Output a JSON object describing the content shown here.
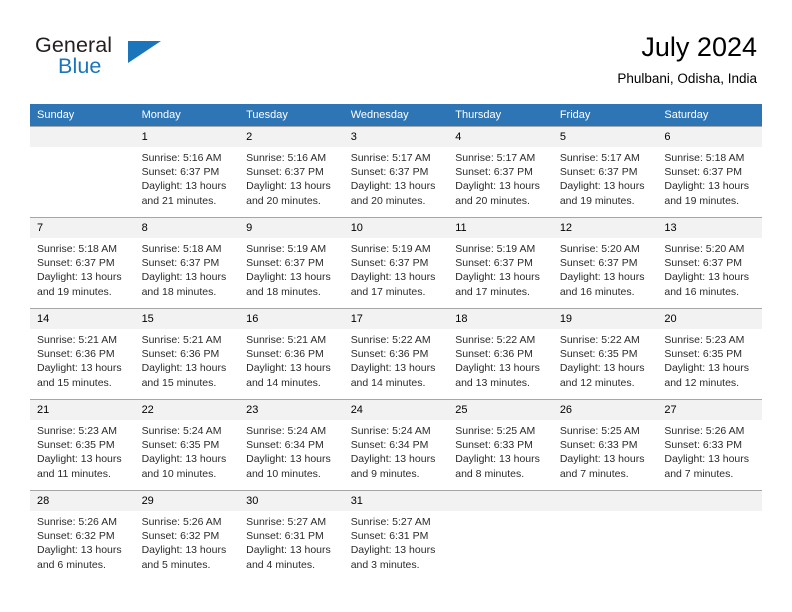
{
  "brand": {
    "name_part1": "General",
    "name_part2": "Blue",
    "accent_color": "#1b75bb"
  },
  "header": {
    "title": "July 2024",
    "subtitle": "Phulbani, Odisha, India"
  },
  "calendar": {
    "header_color": "#2e75b6",
    "weekdays": [
      "Sunday",
      "Monday",
      "Tuesday",
      "Wednesday",
      "Thursday",
      "Friday",
      "Saturday"
    ],
    "weeks": [
      [
        {
          "day": "",
          "sunrise": "",
          "sunset": "",
          "daylight1": "",
          "daylight2": ""
        },
        {
          "day": "1",
          "sunrise": "Sunrise: 5:16 AM",
          "sunset": "Sunset: 6:37 PM",
          "daylight1": "Daylight: 13 hours",
          "daylight2": "and 21 minutes."
        },
        {
          "day": "2",
          "sunrise": "Sunrise: 5:16 AM",
          "sunset": "Sunset: 6:37 PM",
          "daylight1": "Daylight: 13 hours",
          "daylight2": "and 20 minutes."
        },
        {
          "day": "3",
          "sunrise": "Sunrise: 5:17 AM",
          "sunset": "Sunset: 6:37 PM",
          "daylight1": "Daylight: 13 hours",
          "daylight2": "and 20 minutes."
        },
        {
          "day": "4",
          "sunrise": "Sunrise: 5:17 AM",
          "sunset": "Sunset: 6:37 PM",
          "daylight1": "Daylight: 13 hours",
          "daylight2": "and 20 minutes."
        },
        {
          "day": "5",
          "sunrise": "Sunrise: 5:17 AM",
          "sunset": "Sunset: 6:37 PM",
          "daylight1": "Daylight: 13 hours",
          "daylight2": "and 19 minutes."
        },
        {
          "day": "6",
          "sunrise": "Sunrise: 5:18 AM",
          "sunset": "Sunset: 6:37 PM",
          "daylight1": "Daylight: 13 hours",
          "daylight2": "and 19 minutes."
        }
      ],
      [
        {
          "day": "7",
          "sunrise": "Sunrise: 5:18 AM",
          "sunset": "Sunset: 6:37 PM",
          "daylight1": "Daylight: 13 hours",
          "daylight2": "and 19 minutes."
        },
        {
          "day": "8",
          "sunrise": "Sunrise: 5:18 AM",
          "sunset": "Sunset: 6:37 PM",
          "daylight1": "Daylight: 13 hours",
          "daylight2": "and 18 minutes."
        },
        {
          "day": "9",
          "sunrise": "Sunrise: 5:19 AM",
          "sunset": "Sunset: 6:37 PM",
          "daylight1": "Daylight: 13 hours",
          "daylight2": "and 18 minutes."
        },
        {
          "day": "10",
          "sunrise": "Sunrise: 5:19 AM",
          "sunset": "Sunset: 6:37 PM",
          "daylight1": "Daylight: 13 hours",
          "daylight2": "and 17 minutes."
        },
        {
          "day": "11",
          "sunrise": "Sunrise: 5:19 AM",
          "sunset": "Sunset: 6:37 PM",
          "daylight1": "Daylight: 13 hours",
          "daylight2": "and 17 minutes."
        },
        {
          "day": "12",
          "sunrise": "Sunrise: 5:20 AM",
          "sunset": "Sunset: 6:37 PM",
          "daylight1": "Daylight: 13 hours",
          "daylight2": "and 16 minutes."
        },
        {
          "day": "13",
          "sunrise": "Sunrise: 5:20 AM",
          "sunset": "Sunset: 6:37 PM",
          "daylight1": "Daylight: 13 hours",
          "daylight2": "and 16 minutes."
        }
      ],
      [
        {
          "day": "14",
          "sunrise": "Sunrise: 5:21 AM",
          "sunset": "Sunset: 6:36 PM",
          "daylight1": "Daylight: 13 hours",
          "daylight2": "and 15 minutes."
        },
        {
          "day": "15",
          "sunrise": "Sunrise: 5:21 AM",
          "sunset": "Sunset: 6:36 PM",
          "daylight1": "Daylight: 13 hours",
          "daylight2": "and 15 minutes."
        },
        {
          "day": "16",
          "sunrise": "Sunrise: 5:21 AM",
          "sunset": "Sunset: 6:36 PM",
          "daylight1": "Daylight: 13 hours",
          "daylight2": "and 14 minutes."
        },
        {
          "day": "17",
          "sunrise": "Sunrise: 5:22 AM",
          "sunset": "Sunset: 6:36 PM",
          "daylight1": "Daylight: 13 hours",
          "daylight2": "and 14 minutes."
        },
        {
          "day": "18",
          "sunrise": "Sunrise: 5:22 AM",
          "sunset": "Sunset: 6:36 PM",
          "daylight1": "Daylight: 13 hours",
          "daylight2": "and 13 minutes."
        },
        {
          "day": "19",
          "sunrise": "Sunrise: 5:22 AM",
          "sunset": "Sunset: 6:35 PM",
          "daylight1": "Daylight: 13 hours",
          "daylight2": "and 12 minutes."
        },
        {
          "day": "20",
          "sunrise": "Sunrise: 5:23 AM",
          "sunset": "Sunset: 6:35 PM",
          "daylight1": "Daylight: 13 hours",
          "daylight2": "and 12 minutes."
        }
      ],
      [
        {
          "day": "21",
          "sunrise": "Sunrise: 5:23 AM",
          "sunset": "Sunset: 6:35 PM",
          "daylight1": "Daylight: 13 hours",
          "daylight2": "and 11 minutes."
        },
        {
          "day": "22",
          "sunrise": "Sunrise: 5:24 AM",
          "sunset": "Sunset: 6:35 PM",
          "daylight1": "Daylight: 13 hours",
          "daylight2": "and 10 minutes."
        },
        {
          "day": "23",
          "sunrise": "Sunrise: 5:24 AM",
          "sunset": "Sunset: 6:34 PM",
          "daylight1": "Daylight: 13 hours",
          "daylight2": "and 10 minutes."
        },
        {
          "day": "24",
          "sunrise": "Sunrise: 5:24 AM",
          "sunset": "Sunset: 6:34 PM",
          "daylight1": "Daylight: 13 hours",
          "daylight2": "and 9 minutes."
        },
        {
          "day": "25",
          "sunrise": "Sunrise: 5:25 AM",
          "sunset": "Sunset: 6:33 PM",
          "daylight1": "Daylight: 13 hours",
          "daylight2": "and 8 minutes."
        },
        {
          "day": "26",
          "sunrise": "Sunrise: 5:25 AM",
          "sunset": "Sunset: 6:33 PM",
          "daylight1": "Daylight: 13 hours",
          "daylight2": "and 7 minutes."
        },
        {
          "day": "27",
          "sunrise": "Sunrise: 5:26 AM",
          "sunset": "Sunset: 6:33 PM",
          "daylight1": "Daylight: 13 hours",
          "daylight2": "and 7 minutes."
        }
      ],
      [
        {
          "day": "28",
          "sunrise": "Sunrise: 5:26 AM",
          "sunset": "Sunset: 6:32 PM",
          "daylight1": "Daylight: 13 hours",
          "daylight2": "and 6 minutes."
        },
        {
          "day": "29",
          "sunrise": "Sunrise: 5:26 AM",
          "sunset": "Sunset: 6:32 PM",
          "daylight1": "Daylight: 13 hours",
          "daylight2": "and 5 minutes."
        },
        {
          "day": "30",
          "sunrise": "Sunrise: 5:27 AM",
          "sunset": "Sunset: 6:31 PM",
          "daylight1": "Daylight: 13 hours",
          "daylight2": "and 4 minutes."
        },
        {
          "day": "31",
          "sunrise": "Sunrise: 5:27 AM",
          "sunset": "Sunset: 6:31 PM",
          "daylight1": "Daylight: 13 hours",
          "daylight2": "and 3 minutes."
        },
        {
          "day": "",
          "sunrise": "",
          "sunset": "",
          "daylight1": "",
          "daylight2": ""
        },
        {
          "day": "",
          "sunrise": "",
          "sunset": "",
          "daylight1": "",
          "daylight2": ""
        },
        {
          "day": "",
          "sunrise": "",
          "sunset": "",
          "daylight1": "",
          "daylight2": ""
        }
      ]
    ]
  }
}
